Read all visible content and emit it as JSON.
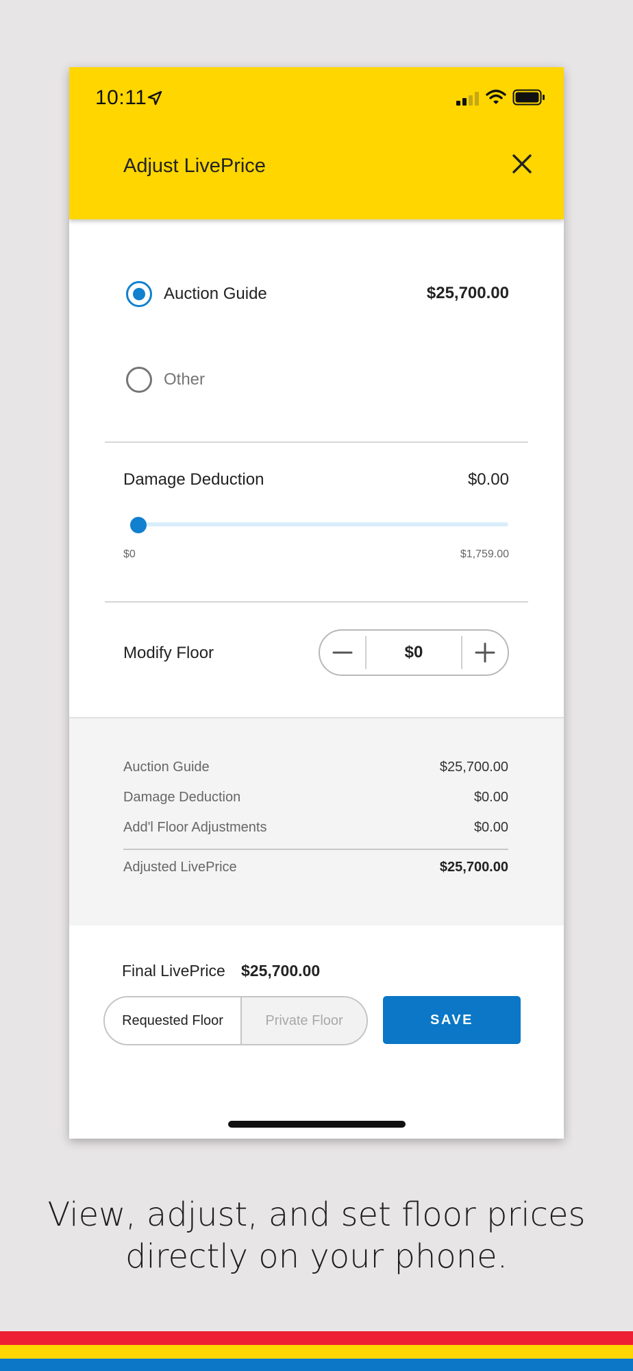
{
  "status_bar": {
    "time": "10:11"
  },
  "header": {
    "title": "Adjust LivePrice"
  },
  "radio_options": [
    {
      "label": "Auction Guide",
      "value": "$25,700.00",
      "selected": true
    },
    {
      "label": "Other",
      "selected": false
    }
  ],
  "damage": {
    "label": "Damage Deduction",
    "value": "$0.00",
    "slider_min_label": "$0",
    "slider_max_label": "$1,759.00",
    "slider_fraction": 0
  },
  "modify_floor": {
    "label": "Modify Floor",
    "value": "$0"
  },
  "summary": {
    "rows": [
      {
        "label": "Auction Guide",
        "value": "$25,700.00"
      },
      {
        "label": "Damage Deduction",
        "value": "$0.00"
      },
      {
        "label": "Add'l Floor Adjustments",
        "value": "$0.00"
      }
    ],
    "total": {
      "label": "Adjusted LivePrice",
      "value": "$25,700.00"
    }
  },
  "final": {
    "label": "Final LivePrice",
    "value": "$25,700.00"
  },
  "floor_toggle": {
    "options": [
      "Requested Floor",
      "Private Floor"
    ],
    "active": "Requested Floor"
  },
  "save_label": "SAVE",
  "caption": {
    "line1": "View, adjust, and set floor prices",
    "line2": "directly on your phone."
  },
  "colors": {
    "header_yellow": "#FFD600",
    "accent_blue": "#0B77C6",
    "stripe_red": "#EE1F34"
  },
  "icons": [
    "location-arrow-icon",
    "cellular-signal-icon",
    "wifi-icon",
    "battery-icon",
    "close-icon",
    "minus-icon",
    "plus-icon"
  ]
}
